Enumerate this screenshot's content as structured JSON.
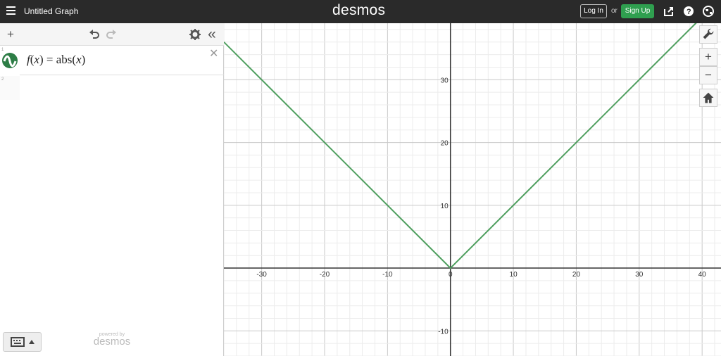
{
  "app": {
    "title": "Untitled Graph",
    "brand": "desmos"
  },
  "header": {
    "login_label": "Log In",
    "or_label": "or",
    "signup_label": "Sign Up"
  },
  "expressions": [
    {
      "index": "1",
      "latex_parts": [
        "f",
        "(",
        "x",
        ")",
        " = ",
        "abs",
        "(",
        "x",
        ")"
      ]
    },
    {
      "index": "2"
    }
  ],
  "footer": {
    "powered_by": "powered by",
    "brand": "desmos"
  },
  "colors": {
    "topbar": "#2a2a2a",
    "accent": "#2f9f4f",
    "graph_line": "#4f9f5f"
  },
  "icons": [
    "hamburger-icon",
    "share-icon",
    "help-icon",
    "globe-icon",
    "plus-icon",
    "undo-icon",
    "redo-icon",
    "settings-icon",
    "collapse-icon",
    "close-icon",
    "wrench-icon",
    "zoom-in-icon",
    "zoom-out-icon",
    "home-icon",
    "keyboard-icon",
    "caret-up-icon"
  ],
  "chart_data": {
    "type": "line",
    "series": [
      {
        "name": "f(x) = abs(x)",
        "x": [
          -36,
          0,
          40
        ],
        "y": [
          36,
          0,
          40
        ]
      }
    ],
    "xlim": [
      -36,
      43
    ],
    "ylim": [
      -14,
      39
    ],
    "x_ticks": [
      -30,
      -20,
      -10,
      0,
      10,
      20,
      30,
      40
    ],
    "y_ticks": [
      -10,
      10,
      20,
      30
    ],
    "grid": true,
    "title": "",
    "xlabel": "",
    "ylabel": ""
  }
}
